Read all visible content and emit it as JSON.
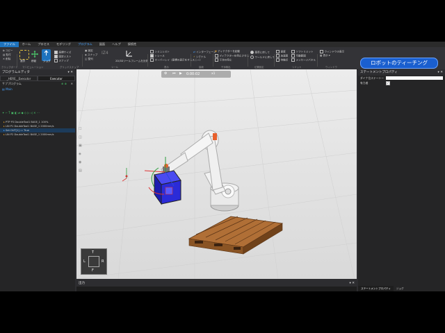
{
  "menu": {
    "items": [
      "ファイル",
      "ホーム",
      "プロセス",
      "モデリング",
      "プログラム",
      "図面",
      "ヘルプ",
      "接続性"
    ],
    "active_index": 0,
    "contextual_index": 4
  },
  "ribbon": {
    "groups": [
      "クリップボード",
      "マニピュレーション",
      "グリッドスナップ",
      "ツール",
      "表示",
      "接続",
      "干渉検出",
      "位置設定",
      "リミット",
      "ウィンドウ"
    ],
    "clipboard": [
      "コピー",
      "貼付",
      "削除"
    ],
    "manip": [
      "選択",
      "移動",
      "ジョグ"
    ],
    "manip_checks": [
      "座標サイズ",
      "固定ミスト",
      "スナップ"
    ],
    "snap": [
      "固定",
      "スナップ",
      "整列"
    ],
    "tools_label": "IZ4",
    "tools_measure": "2D/3Dツールフレームを計測",
    "display": [
      "シミュレスト",
      "トレース",
      "オーバーレイ（座標の表示をするスニー）"
    ],
    "connect": [
      "インターフェース",
      "シグナル"
    ],
    "collision": [
      "ディテクターを起動",
      "ディテクターを停止させる",
      "干渉の停止"
    ],
    "position": [
      "基準に戻して",
      "ワールドに戻して"
    ],
    "limits": [
      "速度",
      "加速度",
      "待機点"
    ],
    "limits2": [
      "ソフトリミット",
      "可動範囲",
      "メッセージパネル"
    ],
    "window": [
      "ウィンドウの表示",
      "表示"
    ],
    "teach_button": "ロボットのティーチング"
  },
  "left_panel": {
    "title": "プログラムエディタ",
    "tabs": [
      "_HERE__Executor",
      "Executor"
    ],
    "subprogram_label": "サブプログラム",
    "main_label": "Main",
    "statements": [
      "PTP P3 DoubleTool1 BASE_1 100%",
      "LIN P1 DoubleTool1 BASE_1 2000mm/s",
      "Set OUT[1] := True",
      "LIN P2 DoubleTool1 BASE_1 2000mm/s"
    ],
    "selected_index": 2
  },
  "viewport": {
    "playback_time": "0:00:02",
    "playback_speed": "x1",
    "nav_cube": [
      "L",
      "T",
      "R",
      "F"
    ]
  },
  "output_panel": {
    "title": "出力"
  },
  "right_panel": {
    "title": "ステートメントプロパティ",
    "prop_name_label": "ダイナ位ステートー",
    "prop_name_value": "",
    "prop_enabled_label": "有力者",
    "prop_enabled": true,
    "bottom_tabs": [
      "ステートメントプロパティ",
      "ジョグ"
    ]
  },
  "colors": {
    "accent": "#1e73be",
    "teach_button": "#1a5fcf",
    "pallet": "#a0612e",
    "box_blue": "#2b2bd8",
    "robot_orange": "#e8602c"
  }
}
